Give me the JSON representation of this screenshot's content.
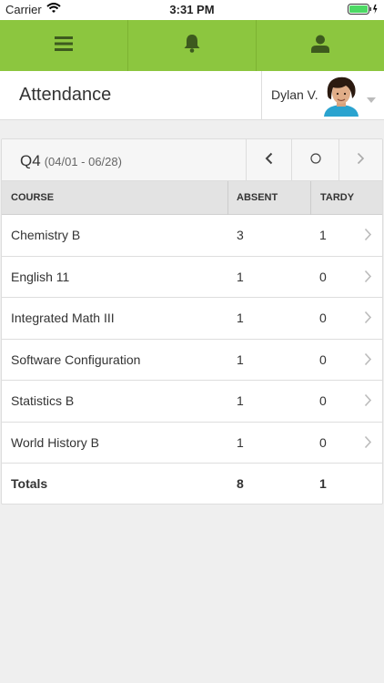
{
  "status_bar": {
    "carrier": "Carrier",
    "time": "3:31 PM"
  },
  "toolbar": {
    "icons": [
      "menu-icon",
      "bell-icon",
      "user-icon"
    ]
  },
  "header": {
    "title": "Attendance",
    "user_name": "Dylan V."
  },
  "quarter": {
    "name": "Q4",
    "range": "(04/01 - 06/28)"
  },
  "table": {
    "columns": [
      "COURSE",
      "ABSENT",
      "TARDY"
    ],
    "rows": [
      {
        "course": "Chemistry B",
        "absent": "3",
        "tardy": "1"
      },
      {
        "course": "English 11",
        "absent": "1",
        "tardy": "0"
      },
      {
        "course": "Integrated Math III",
        "absent": "1",
        "tardy": "0"
      },
      {
        "course": "Software Configuration",
        "absent": "1",
        "tardy": "0"
      },
      {
        "course": "Statistics B",
        "absent": "1",
        "tardy": "0"
      },
      {
        "course": "World History B",
        "absent": "1",
        "tardy": "0"
      }
    ],
    "totals": {
      "label": "Totals",
      "absent": "8",
      "tardy": "1"
    }
  },
  "colors": {
    "accent": "#8cc63f",
    "icon_dark": "#3d5a1e",
    "background": "#efefef"
  }
}
